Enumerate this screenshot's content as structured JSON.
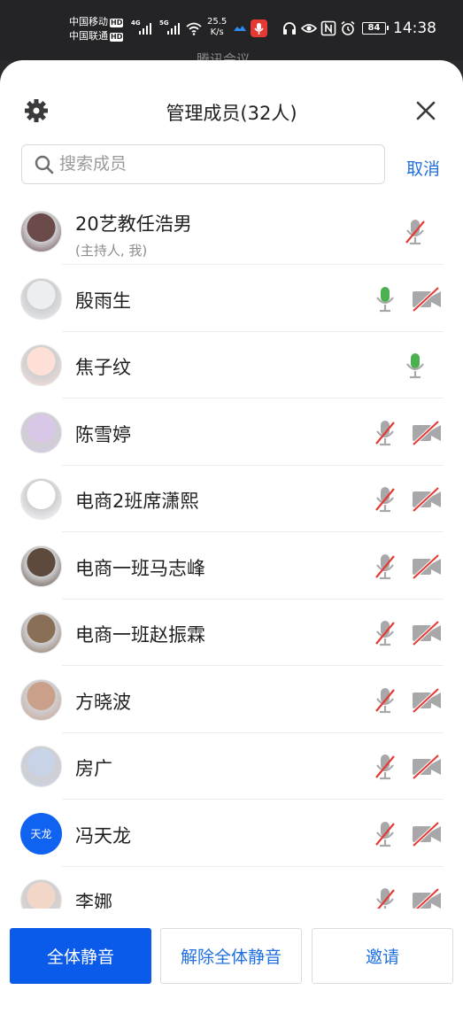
{
  "status_bar": {
    "carrier1": "中国移动",
    "carrier2": "中国联通",
    "hd": "HD",
    "sig1": "4G",
    "sig2": "5G",
    "net_speed_value": "25.5",
    "net_speed_unit": "K/s",
    "battery": "84",
    "time": "14:38"
  },
  "behind_title": "腾讯会议",
  "header": {
    "title": "管理成员(32人)"
  },
  "search": {
    "placeholder": "搜索成员",
    "cancel_label": "取消"
  },
  "members": [
    {
      "name": "20艺教任浩男",
      "sub": "(主持人, 我)",
      "avatar": "photo",
      "mic": "muted",
      "cam": "none"
    },
    {
      "name": "殷雨生",
      "avatar": "photo",
      "mic": "on",
      "cam": "off"
    },
    {
      "name": "焦子纹",
      "avatar": "photo",
      "mic": "on",
      "cam": "none"
    },
    {
      "name": "陈雪婷",
      "avatar": "photo",
      "mic": "muted",
      "cam": "off"
    },
    {
      "name": "电商2班席潇熙",
      "avatar": "photo",
      "mic": "muted",
      "cam": "off"
    },
    {
      "name": "电商一班马志峰",
      "avatar": "photo",
      "mic": "muted",
      "cam": "off"
    },
    {
      "name": "电商一班赵振霖",
      "avatar": "photo",
      "mic": "muted",
      "cam": "off"
    },
    {
      "name": "方晓波",
      "avatar": "photo",
      "mic": "muted",
      "cam": "off"
    },
    {
      "name": "房广",
      "avatar": "photo",
      "mic": "muted",
      "cam": "off"
    },
    {
      "name": "冯天龙",
      "avatar_text": "天龙",
      "mic": "muted",
      "cam": "off"
    },
    {
      "name": "李娜",
      "avatar": "photo",
      "mic": "muted",
      "cam": "off"
    }
  ],
  "footer": {
    "mute_all": "全体静音",
    "unmute_all": "解除全体静音",
    "invite": "邀请"
  },
  "colors": {
    "accent": "#1062f0",
    "mic_on": "#4caf50",
    "muted_slash": "#e53935",
    "icon_gray": "#a8a8aa"
  }
}
